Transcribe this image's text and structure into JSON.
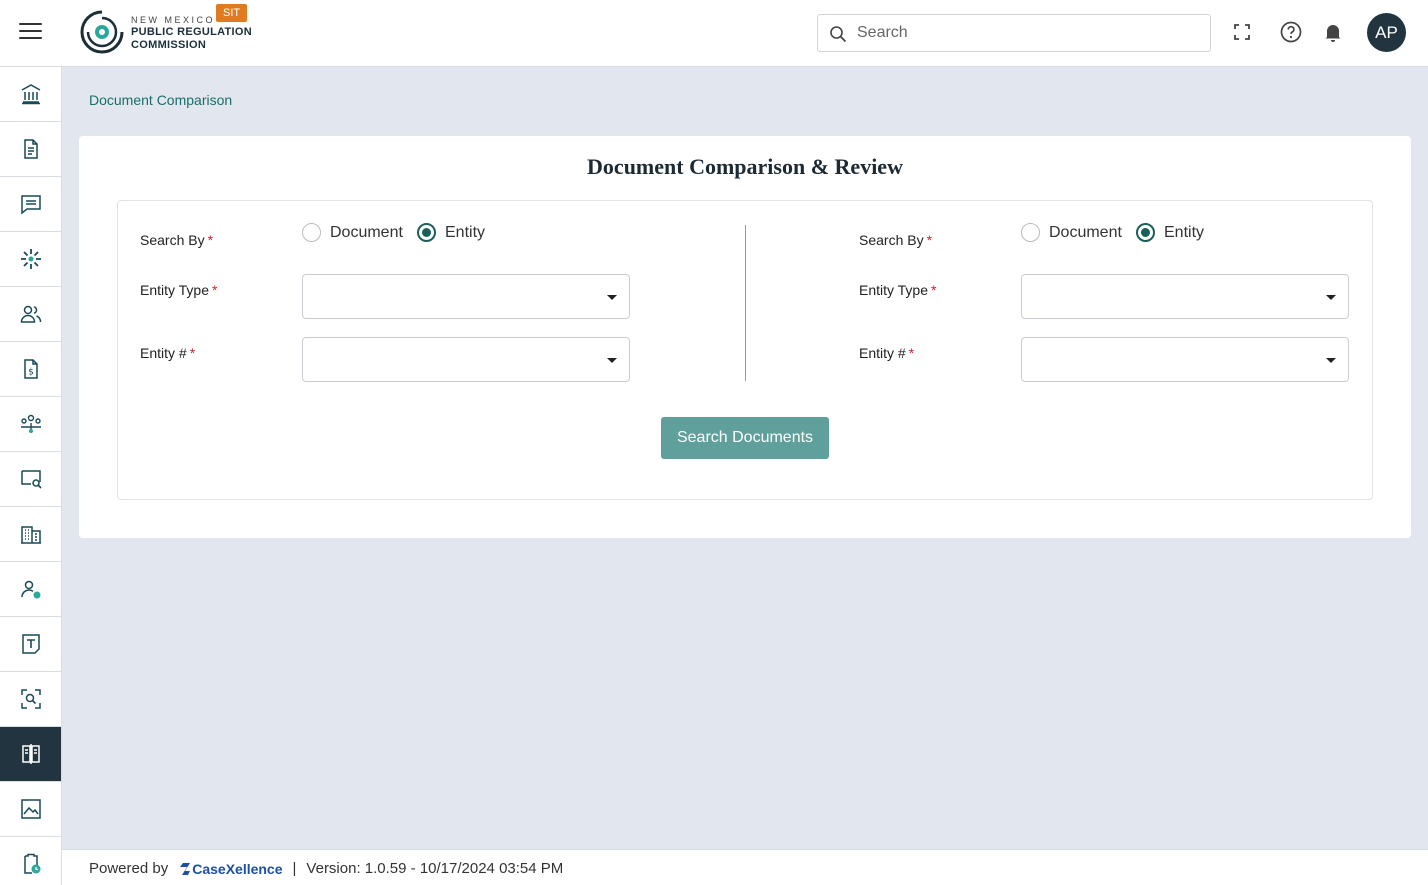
{
  "header": {
    "logo_line1": "NEW MEXICO",
    "logo_line2": "PUBLIC REGULATION",
    "logo_line3": "COMMISSION",
    "env_badge": "SIT",
    "search_placeholder": "Search",
    "avatar_initials": "AP"
  },
  "sidebar": {
    "items": [
      {
        "icon": "institution-icon"
      },
      {
        "icon": "document-icon"
      },
      {
        "icon": "message-icon"
      },
      {
        "icon": "loader-icon"
      },
      {
        "icon": "users-icon"
      },
      {
        "icon": "invoice-icon"
      },
      {
        "icon": "team-icon"
      },
      {
        "icon": "screen-search-icon"
      },
      {
        "icon": "building-icon"
      },
      {
        "icon": "user-settings-icon"
      },
      {
        "icon": "text-box-icon"
      },
      {
        "icon": "scan-search-icon"
      },
      {
        "icon": "compare-icon",
        "active": true
      },
      {
        "icon": "image-icon"
      },
      {
        "icon": "clipboard-clock-icon"
      }
    ]
  },
  "breadcrumb": "Document Comparison",
  "page": {
    "title": "Document Comparison & Review",
    "left": {
      "search_by_label": "Search By",
      "option_document": "Document",
      "option_entity": "Entity",
      "selected": "Entity",
      "entity_type_label": "Entity Type",
      "entity_number_label": "Entity #"
    },
    "right": {
      "search_by_label": "Search By",
      "option_document": "Document",
      "option_entity": "Entity",
      "selected": "Entity",
      "entity_type_label": "Entity Type",
      "entity_number_label": "Entity #"
    },
    "search_button": "Search Documents",
    "required_marker": "*"
  },
  "footer": {
    "powered_by": "Powered by",
    "brand_case": "Case",
    "brand_x": "X",
    "brand_rest": "ellence",
    "separator": "|",
    "version": "Version: 1.0.59 - 10/17/2024 03:54 PM"
  },
  "colors": {
    "accent": "#16706b",
    "primary_dark": "#22343f",
    "button": "#5fa09c",
    "required": "#d2232a",
    "badge": "#e07b1f"
  }
}
